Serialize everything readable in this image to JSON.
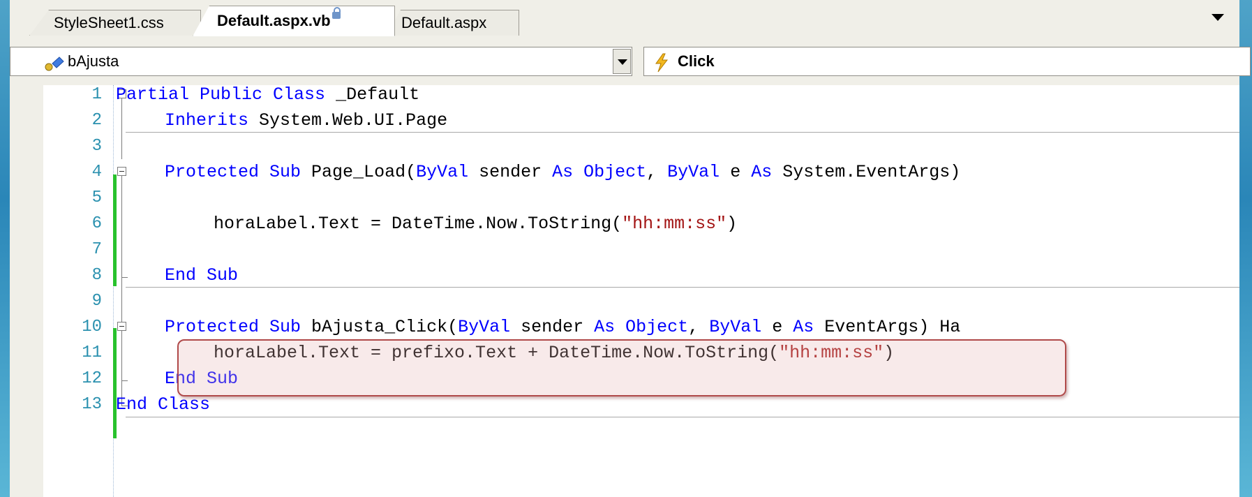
{
  "tabs": [
    {
      "label": "StyleSheet1.css"
    },
    {
      "label": "Default.aspx.vb",
      "locked": true,
      "active": true
    },
    {
      "label": "Default.aspx"
    }
  ],
  "navbar": {
    "member_combo": "bAjusta",
    "member_icon": "member-key-icon",
    "event_combo": "Click",
    "event_icon": "lightning-icon"
  },
  "editor": {
    "lines": [
      {
        "n": "1"
      },
      {
        "n": "2"
      },
      {
        "n": "3"
      },
      {
        "n": "4"
      },
      {
        "n": "5"
      },
      {
        "n": "6"
      },
      {
        "n": "7"
      },
      {
        "n": "8"
      },
      {
        "n": "9"
      },
      {
        "n": "10"
      },
      {
        "n": "11"
      },
      {
        "n": "12"
      },
      {
        "n": "13"
      }
    ],
    "code": {
      "l1": {
        "kw": "Partial Public Class",
        "rest": " _Default"
      },
      "l2": {
        "kw": "Inherits",
        "rest": " System.Web.UI.Page"
      },
      "l4": {
        "kw1": "Protected Sub",
        "t1": " Page_Load(",
        "kw2": "ByVal",
        "t2": " sender ",
        "kw3": "As Object",
        "t3": ", ",
        "kw4": "ByVal",
        "t4": " e ",
        "kw5": "As",
        "t5": " System.EventArgs)"
      },
      "l6": {
        "t1": "horaLabel.Text = DateTime.Now.ToString(",
        "str": "\"hh:mm:ss\"",
        "t2": ")"
      },
      "l8": {
        "kw": "End Sub"
      },
      "l10": {
        "kw1": "Protected Sub",
        "t1": " bAjusta_Click(",
        "kw2": "ByVal",
        "t2": " sender ",
        "kw3": "As Object",
        "t3": ", ",
        "kw4": "ByVal",
        "t4": " e ",
        "kw5": "As",
        "t5": " EventArgs) Ha"
      },
      "l11": {
        "t1": "horaLabel.Text = prefixo.Text + DateTime.Now.ToString(",
        "str": "\"hh:mm:ss\"",
        "t2": ")"
      },
      "l12": {
        "kw": "End Sub"
      },
      "l13": {
        "kw": "End Class"
      }
    }
  },
  "colors": {
    "keyword": "#0000ff",
    "string": "#a31515",
    "line_number": "#2b91af",
    "changed_bar": "#29c22d",
    "highlight_border": "#b04a4a"
  }
}
